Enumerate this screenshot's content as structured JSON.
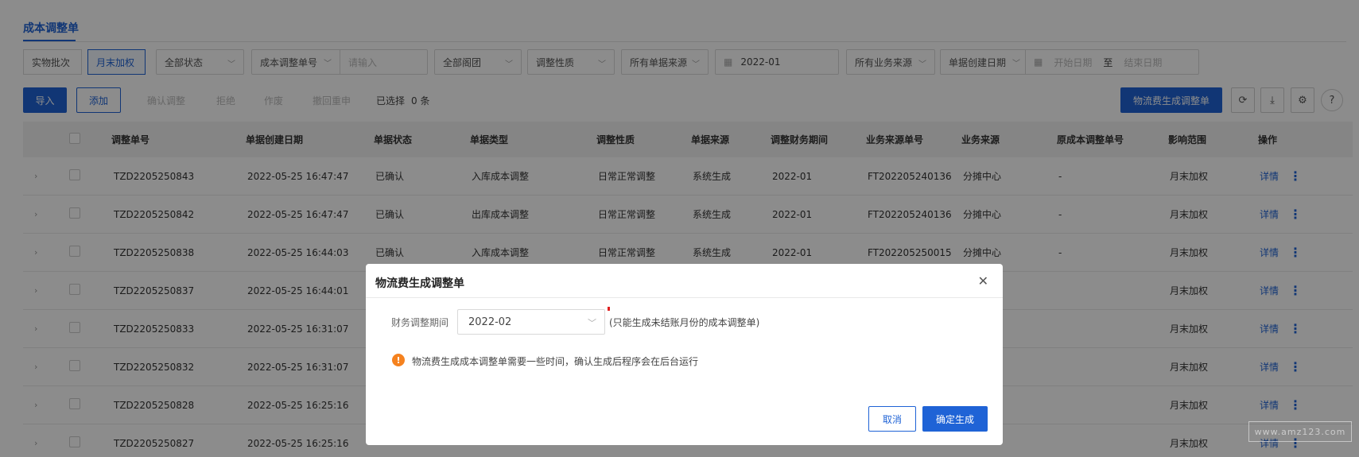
{
  "page": {
    "title": "成本调整单"
  },
  "filters": {
    "tabs": [
      "实物批次",
      "月末加权"
    ],
    "status_select": "全部状态",
    "doc_no_field_select": "成本调整单号",
    "doc_no_placeholder": "请输入",
    "warehouse_select": "全部阁团",
    "nature_select": "调整性质",
    "doc_source_select": "所有单据来源",
    "period_value": "2022-01",
    "biz_source_select": "所有业务来源",
    "date_field_select": "单据创建日期",
    "date_start_placeholder": "开始日期",
    "date_sep": "至",
    "date_end_placeholder": "结束日期"
  },
  "toolbar": {
    "import_label": "导入",
    "add_label": "添加",
    "confirm_label": "确认调整",
    "reject_label": "拒绝",
    "void_label": "作废",
    "withdraw_label": "撤回重申",
    "selected_label": "已选择",
    "selected_count": "0 条",
    "logistics_label": "物流费生成调整单"
  },
  "table": {
    "columns": [
      "调整单号",
      "单据创建日期",
      "单据状态",
      "单据类型",
      "调整性质",
      "单据来源",
      "调整财务期间",
      "业务来源单号",
      "业务来源",
      "原成本调整单号",
      "影响范围",
      "操作"
    ],
    "rows": [
      [
        "TZD2205250843",
        "2022-05-25 16:47:47",
        "已确认",
        "入库成本调整",
        "日常正常调整",
        "系统生成",
        "2022-01",
        "FT202205240136",
        "分摊中心",
        "-",
        "月末加权"
      ],
      [
        "TZD2205250842",
        "2022-05-25 16:47:47",
        "已确认",
        "出库成本调整",
        "日常正常调整",
        "系统生成",
        "2022-01",
        "FT202205240136",
        "分摊中心",
        "-",
        "月末加权"
      ],
      [
        "TZD2205250838",
        "2022-05-25 16:44:03",
        "已确认",
        "入库成本调整",
        "日常正常调整",
        "系统生成",
        "2022-01",
        "FT202205250015",
        "分摊中心",
        "-",
        "月末加权"
      ],
      [
        "TZD2205250837",
        "2022-05-25 16:44:01",
        "",
        "",
        "",
        "",
        "",
        "",
        "",
        "",
        "月末加权"
      ],
      [
        "TZD2205250833",
        "2022-05-25 16:31:07",
        "",
        "",
        "",
        "",
        "",
        "",
        "",
        "",
        "月末加权"
      ],
      [
        "TZD2205250832",
        "2022-05-25 16:31:07",
        "",
        "",
        "",
        "",
        "",
        "",
        "",
        "",
        "月末加权"
      ],
      [
        "TZD2205250828",
        "2022-05-25 16:25:16",
        "",
        "",
        "",
        "",
        "",
        "",
        "",
        "",
        "月末加权"
      ],
      [
        "TZD2205250827",
        "2022-05-25 16:25:16",
        "",
        "",
        "",
        "",
        "",
        "",
        "",
        "",
        "月末加权"
      ]
    ],
    "action_label": "详情",
    "more_icon": "⋮"
  },
  "modal": {
    "title": "物流费生成调整单",
    "period_label": "财务调整期间",
    "period_value": "2022-02",
    "period_note": "(只能生成未结账月份的成本调整单)",
    "warning_text": "物流费生成成本调整单需要一些时间，确认生成后程序会在后台运行",
    "cancel_label": "取消",
    "confirm_label": "确定生成"
  },
  "watermark": "www.amz123.com",
  "colors": {
    "accent": "#1f63d6",
    "warning": "#f5821f",
    "overlay": "#000000"
  }
}
